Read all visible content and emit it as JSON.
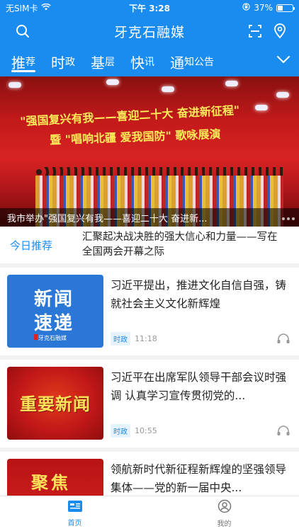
{
  "status_bar": {
    "carrier": "无SIM卡",
    "time": "下午 3:28",
    "battery": "37%",
    "battery_level": 0.37
  },
  "header": {
    "title": "牙克石融媒"
  },
  "tabs": [
    {
      "big": "推",
      "small": "荐"
    },
    {
      "big": "时",
      "small": "政"
    },
    {
      "big": "基",
      "small": "层"
    },
    {
      "big": "快",
      "small": "讯"
    },
    {
      "big": "通",
      "small": "知公告"
    }
  ],
  "banner": {
    "stage_line1": "\"强国复兴有我——喜迎二十大 奋进新征程\"",
    "stage_line2": "暨 \"唱响北疆 爱我国防\" 歌咏展演",
    "caption": "我市举办\"强国复兴有我——喜迎二十大 奋进新..."
  },
  "today": {
    "label": "今日推荐",
    "text": "汇聚起决战决胜的强大信心和力量——写在全国两会开幕之际"
  },
  "news": [
    {
      "thumb_lines": [
        "新闻",
        "速递"
      ],
      "thumb_brand": "牙克石融媒",
      "title": "习近平提出，推进文化自信自强，铸就社会主义文化新辉煌",
      "tag": "时政",
      "time": "11:18"
    },
    {
      "thumb_lines": [
        "重要新闻"
      ],
      "title": "习近平在出席军队领导干部会议时强调 认真学习宣传贯彻党的...",
      "tag": "时政",
      "time": "10:55"
    },
    {
      "thumb_lines": [
        "聚焦"
      ],
      "title": "领航新时代新征程新辉煌的坚强领导集体——党的新一届中央..."
    }
  ],
  "tabbar": [
    {
      "label": "首页"
    },
    {
      "label": "我的"
    }
  ],
  "colors": {
    "brand": "#1a8cf0"
  }
}
